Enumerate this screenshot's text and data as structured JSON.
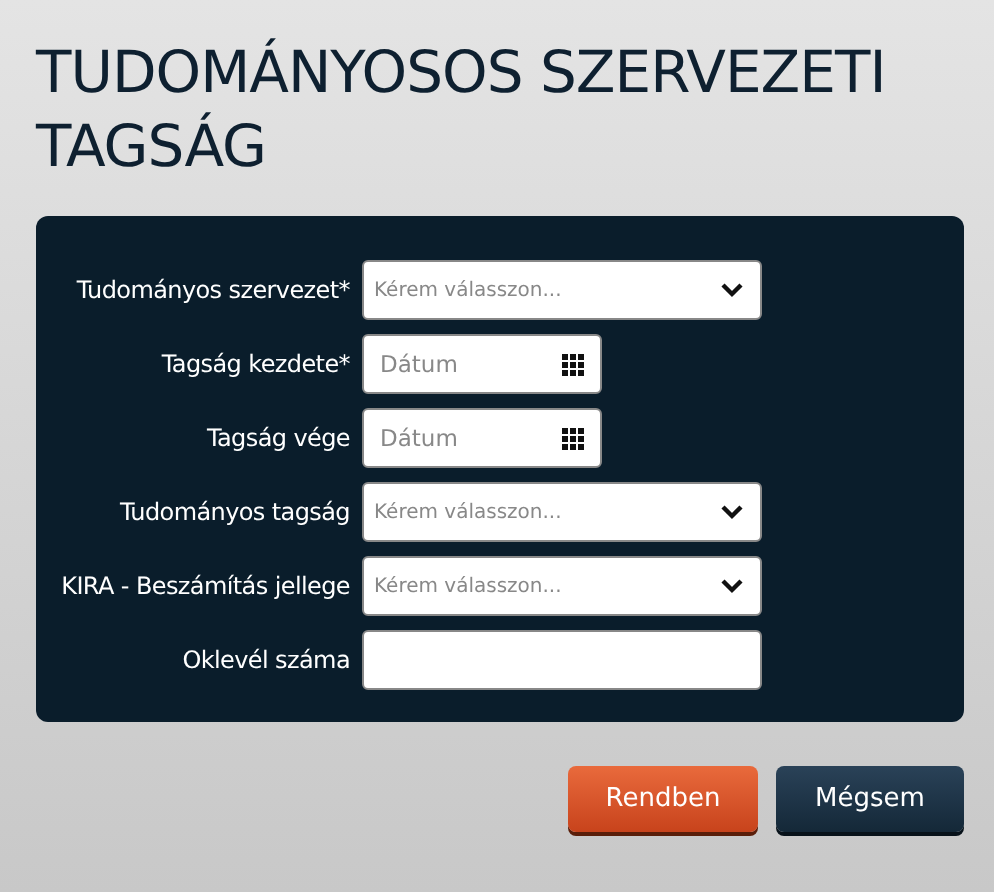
{
  "title": "TUDOMÁNYOSOS SZERVEZETI TAGSÁG",
  "fields": [
    {
      "label": "Tudományos szervezet*",
      "kind": "select",
      "placeholder": "Kérem válasszon..."
    },
    {
      "label": "Tagság kezdete*",
      "kind": "date",
      "placeholder": "Dátum"
    },
    {
      "label": "Tagság vége",
      "kind": "date",
      "placeholder": "Dátum"
    },
    {
      "label": "Tudományos tagság",
      "kind": "select",
      "placeholder": "Kérem válasszon..."
    },
    {
      "label": "KIRA - Beszámítás jellege",
      "kind": "select",
      "placeholder": "Kérem válasszon..."
    },
    {
      "label": "Oklevél száma",
      "kind": "text"
    }
  ],
  "buttons": [
    {
      "label": "Rendben",
      "kind": "primary"
    },
    {
      "label": "Mégsem",
      "kind": "secondary"
    }
  ]
}
